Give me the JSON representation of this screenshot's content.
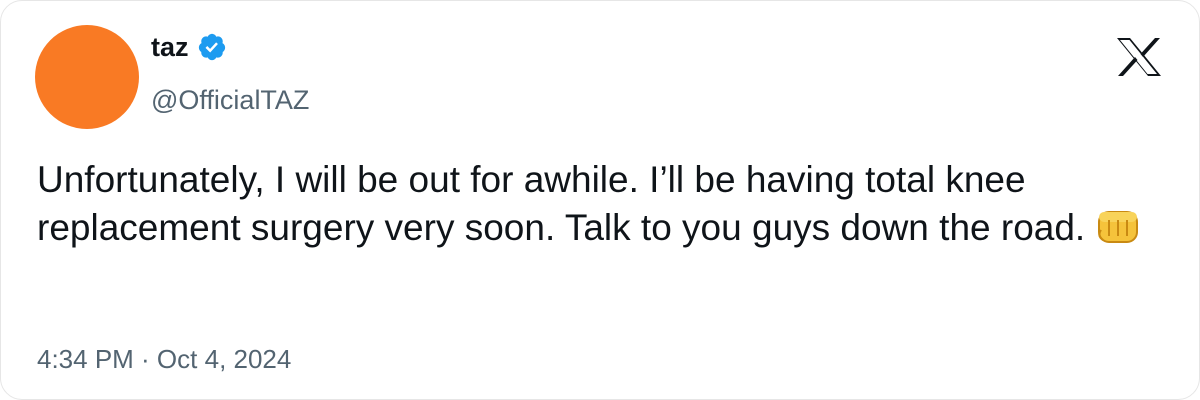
{
  "tweet": {
    "author": {
      "display_name": "taz",
      "handle": "@OfficialTAZ",
      "verified": true,
      "avatar_color": "#f97a24"
    },
    "text": "Unfortunately, I will be out for awhile. I’ll be having total knee replacement surgery very soon. Talk to you guys down the road.",
    "emoji": "oncoming-fist",
    "timestamp": "4:34 PM · Oct 4, 2024"
  },
  "platform_logo": "x-logo-icon",
  "colors": {
    "text_primary": "#0f1419",
    "text_secondary": "#536471",
    "verified_blue": "#1d9bf0",
    "border": "#e6e6e6"
  }
}
